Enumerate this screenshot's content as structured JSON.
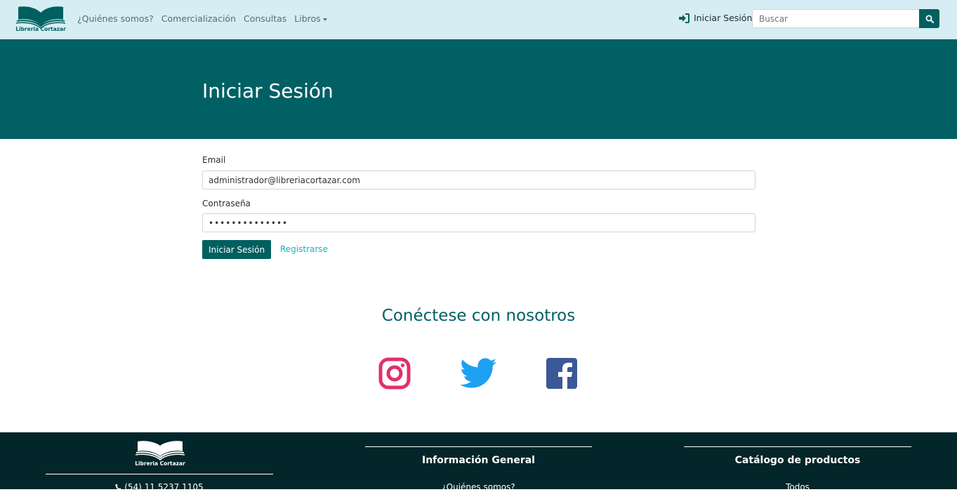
{
  "brand": {
    "name": "Libreria Cortazar"
  },
  "nav": {
    "items": [
      {
        "label": "¿Quiénes somos?"
      },
      {
        "label": "Comercialización"
      },
      {
        "label": "Consultas"
      },
      {
        "label": "Libros"
      }
    ],
    "login_label": "Iniciar Sesión"
  },
  "search": {
    "placeholder": "Buscar",
    "value": ""
  },
  "hero": {
    "title": "Iniciar Sesión"
  },
  "form": {
    "email_label": "Email",
    "email_value": "administrador@libreriacortazar.com",
    "password_label": "Contraseña",
    "password_value": "••••••••••••••",
    "submit_label": "Iniciar Sesión",
    "register_label": "Registrarse"
  },
  "connect": {
    "title": "Conéctese con nosotros"
  },
  "footer": {
    "phone": "(54) 11 5237 1105",
    "info_heading": "Información General",
    "info_first_link": "¿Quiénes somos?",
    "catalog_heading": "Catálogo de productos",
    "catalog_first_link": "Todos"
  },
  "colors": {
    "navbar_bg": "#d6eef3",
    "primary": "#00605f",
    "hero_bg": "#006064",
    "link": "#17b3c1",
    "footer_bg": "#022629",
    "instagram": "#e1306c",
    "twitter": "#1da1f2",
    "facebook": "#3b5998"
  },
  "icons": [
    "book-logo",
    "sign-in-icon",
    "search-icon",
    "instagram-icon",
    "twitter-icon",
    "facebook-icon",
    "phone-icon"
  ]
}
